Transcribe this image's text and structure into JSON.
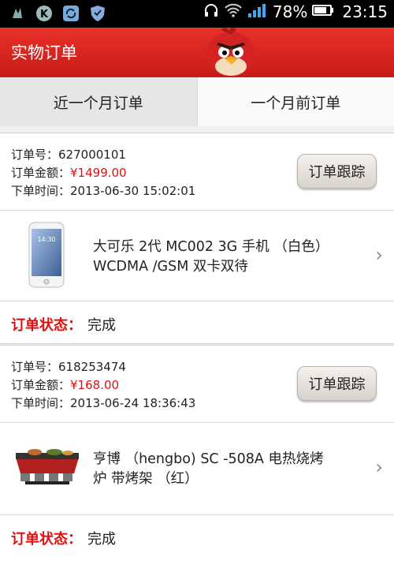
{
  "status_bar": {
    "battery_percent": "78%",
    "time": "23:15"
  },
  "header": {
    "title": "实物订单"
  },
  "tabs": [
    {
      "label": "近一个月订单"
    },
    {
      "label": "一个月前订单"
    }
  ],
  "labels": {
    "order_no": "订单号：",
    "order_amount": "订单金额：",
    "order_time": "下单时间：",
    "track_button": "订单跟踪",
    "status_label": "订单状态："
  },
  "orders": [
    {
      "order_no": "627000101",
      "amount": "¥1499.00",
      "time": "2013-06-30 15:02:01",
      "product_name": "大可乐 2代 MC002 3G 手机 （白色）WCDMA /GSM 双卡双待",
      "status": "完成"
    },
    {
      "order_no": "618253474",
      "amount": "¥168.00",
      "time": "2013-06-24 18:36:43",
      "product_name": "亨博 （hengbo) SC -508A 电热烧烤炉 带烤架 （红）",
      "status": "完成"
    }
  ],
  "colors": {
    "brand_red": "#d8231f",
    "price_red": "#e01010"
  }
}
